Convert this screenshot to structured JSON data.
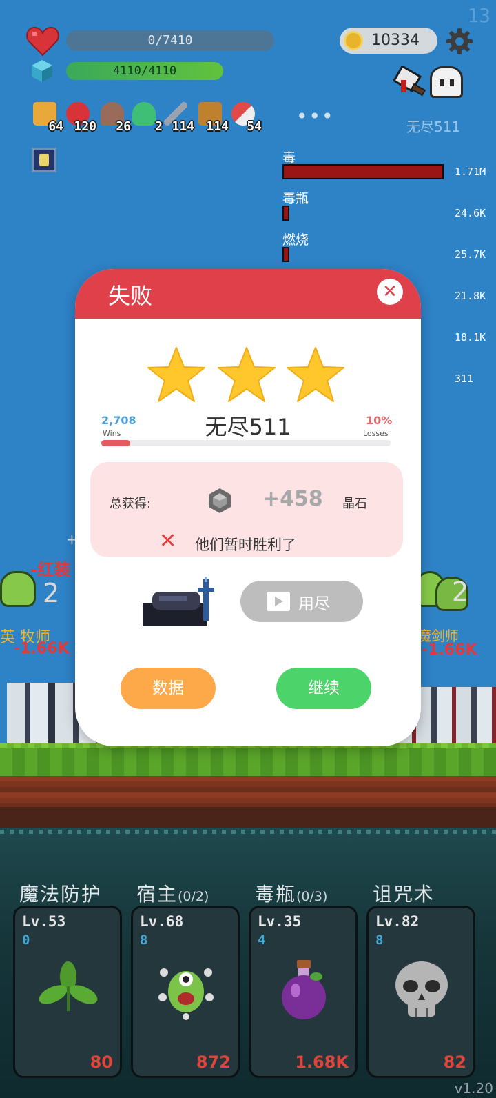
{
  "corner_number": "13",
  "hud": {
    "hp": "0/7410",
    "mp": "4110/4110",
    "gold": "10334",
    "more": "•••",
    "stage": "无尽511"
  },
  "items": [
    {
      "icon": "beer-mug-icon",
      "count": "64",
      "color": "#e8a93a"
    },
    {
      "icon": "apple-icon",
      "count": "120",
      "color": "#d9333a"
    },
    {
      "icon": "tombstone-icon",
      "count": "26",
      "color": "#9a6a5a"
    },
    {
      "icon": "potion-flask-icon",
      "count": "2",
      "color": "#3fbf75"
    },
    {
      "icon": "sword-icon",
      "count": "114",
      "color": "#9aa3ad"
    },
    {
      "icon": "spellbook-icon",
      "count": "114",
      "color": "#c0812e"
    },
    {
      "icon": "pill-capsule-icon",
      "count": "54",
      "color": "#e24a4a"
    }
  ],
  "damage": [
    {
      "label": "毒",
      "value": "1.71M",
      "fill": 1.0
    },
    {
      "label": "毒瓶",
      "value": "24.6K",
      "fill": 0.02
    },
    {
      "label": "燃烧",
      "value": "25.7K",
      "fill": 0.02
    },
    {
      "label": "",
      "value": "21.8K",
      "fill": 0
    },
    {
      "label": "",
      "value": "18.1K",
      "fill": 0
    },
    {
      "label": "",
      "value": "311",
      "fill": 0
    }
  ],
  "battle": {
    "num_left": "2",
    "num_right": "2",
    "red_left": "-红装",
    "red_left2": "-1.66K",
    "red_right": "-1.66K",
    "yellow_left": "英  牧师",
    "yellow_right": "魔剑师",
    "plus_left": "+"
  },
  "modal": {
    "title": "失败",
    "close": "✕",
    "stars": 3,
    "wins_count": "2,708",
    "wins_label": "Wins",
    "losses_pct": "10%",
    "losses_label": "Losses",
    "loss_ratio": 0.1,
    "stage_name": "无尽511",
    "reward_label": "总获得:",
    "reward_amount": "+458",
    "reward_unit": "晶石",
    "result_message": "他们暂时胜利了",
    "video_button": "用尽",
    "data_button": "数据",
    "continue_button": "继续"
  },
  "skills": [
    {
      "name": "魔法防护",
      "sub": "",
      "level": "Lv.53",
      "count": "0",
      "cost": "80",
      "icon": "leaf-sprout-icon"
    },
    {
      "name": "宿主",
      "sub": "(0/2)",
      "level": "Lv.68",
      "count": "8",
      "cost": "872",
      "icon": "green-monster-icon"
    },
    {
      "name": "毒瓶",
      "sub": "(0/3)",
      "level": "Lv.35",
      "count": "4",
      "cost": "1.68K",
      "icon": "poison-bottle-icon"
    },
    {
      "name": "诅咒术",
      "sub": "",
      "level": "Lv.82",
      "count": "8",
      "cost": "82",
      "icon": "skull-icon"
    }
  ],
  "version": "v1.20",
  "colors": {
    "header_red": "#e0404a",
    "orange_button": "#fda94a",
    "green_button": "#4cd46a",
    "star": "#ffc72c",
    "cost_red": "#e0453c"
  }
}
